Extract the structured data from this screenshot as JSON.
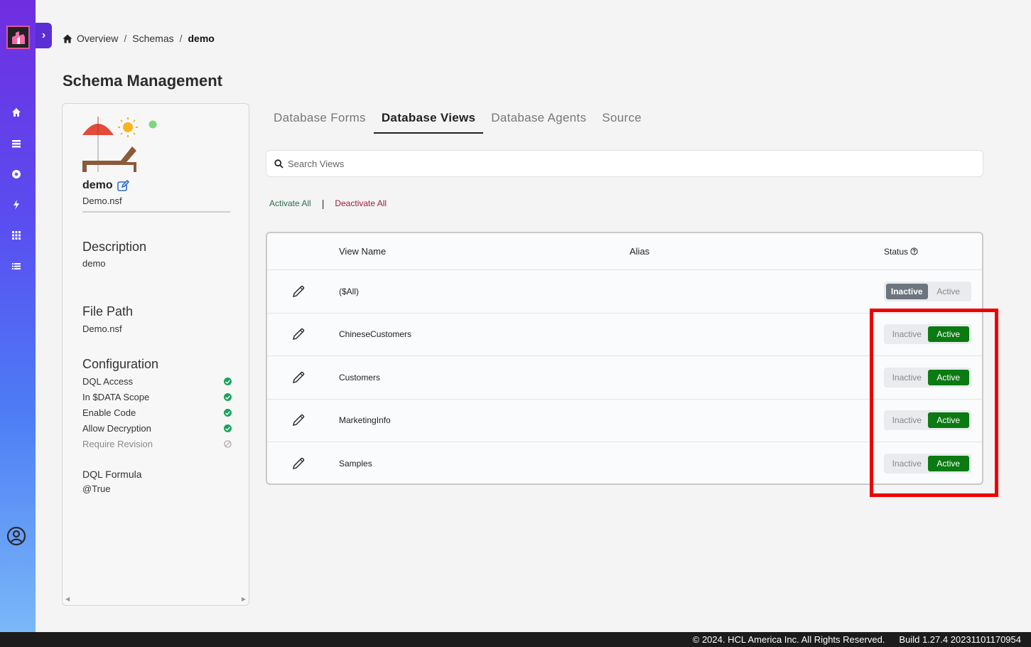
{
  "breadcrumb": {
    "home": "Overview",
    "schemas": "Schemas",
    "current": "demo"
  },
  "page_title": "Schema Management",
  "schema": {
    "name": "demo",
    "file": "Demo.nsf",
    "status_color": "#7ed67e",
    "description_title": "Description",
    "description_value": "demo",
    "filepath_title": "File Path",
    "filepath_value": "Demo.nsf",
    "config_title": "Configuration",
    "config": [
      {
        "label": "DQL Access",
        "enabled": true
      },
      {
        "label": "In $DATA Scope",
        "enabled": true
      },
      {
        "label": "Enable Code",
        "enabled": true
      },
      {
        "label": "Allow Decryption",
        "enabled": true
      },
      {
        "label": "Require Revision",
        "enabled": false
      }
    ],
    "formula_title": "DQL Formula",
    "formula_value": "@True"
  },
  "tabs": [
    {
      "label": "Database Forms",
      "active": false
    },
    {
      "label": "Database Views",
      "active": true
    },
    {
      "label": "Database Agents",
      "active": false
    },
    {
      "label": "Source",
      "active": false
    }
  ],
  "search": {
    "placeholder": "Search Views",
    "value": ""
  },
  "bulk": {
    "activate_all": "Activate All",
    "separator": "|",
    "deactivate_all": "Deactivate All"
  },
  "table": {
    "headers": {
      "view_name": "View Name",
      "alias": "Alias",
      "status": "Status"
    },
    "toggle_labels": {
      "inactive": "Inactive",
      "active": "Active"
    },
    "rows": [
      {
        "name": "($All)",
        "alias": "",
        "status": "Inactive"
      },
      {
        "name": "ChineseCustomers",
        "alias": "",
        "status": "Active"
      },
      {
        "name": "Customers",
        "alias": "",
        "status": "Active"
      },
      {
        "name": "MarketingInfo",
        "alias": "",
        "status": "Active"
      },
      {
        "name": "Samples",
        "alias": "",
        "status": "Active"
      }
    ]
  },
  "footer": {
    "copyright": "© 2024. HCL America Inc. All Rights Reserved.",
    "build": "Build 1.27.4 20231101170954"
  },
  "colors": {
    "active_green": "#0b7a12",
    "inactive_gray": "#6c757d",
    "highlight_red": "#ee0000"
  }
}
